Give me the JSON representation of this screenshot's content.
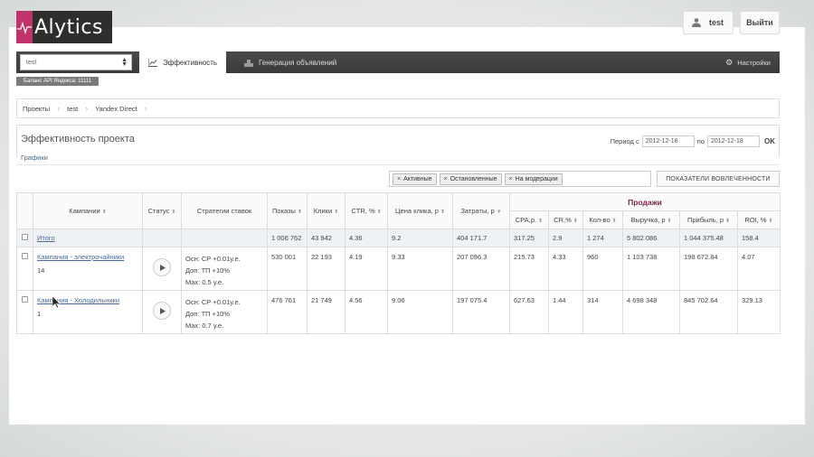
{
  "header": {
    "logo_text": "Alytics",
    "user_name": "test",
    "logout_label": "Выйти"
  },
  "navbar": {
    "project_select_value": "test",
    "tabs": [
      {
        "label": "Эффективность",
        "icon": "chart-line-icon",
        "active": true
      },
      {
        "label": "Генерация объявлений",
        "icon": "generator-icon",
        "active": false
      }
    ],
    "settings_label": "Настройки"
  },
  "api_balance": "Баланс API Яндекса: 11111",
  "breadcrumb": [
    "Проекты",
    "test",
    "Yandex Direct"
  ],
  "panel": {
    "title": "Эффективность проекта",
    "charts_link": "Графики",
    "period_label_from": "Период с",
    "period_from": "2012-12-18",
    "period_label_to": "по",
    "period_to": "2012-12-18",
    "ok_label": "OK"
  },
  "filters": {
    "tags": [
      "Активные",
      "Остановленные",
      "На модерации"
    ],
    "engagement_button": "ПОКАЗАТЕЛИ ВОВЛЕЧЕННОСТИ"
  },
  "table": {
    "sales_group_label": "Продажи",
    "columns": {
      "campaigns": "Кампании",
      "status": "Статус",
      "strategies": "Стратегии ставок",
      "impressions": "Показы",
      "clicks": "Клики",
      "ctr": "CTR, %",
      "cpc": "Цена клика, р",
      "cost": "Затраты, р",
      "cpa": "CPA,р.",
      "cr": "CR,%",
      "qty": "Кол-во",
      "revenue": "Выручка, р",
      "profit": "Прибыль, р",
      "roi": "ROI, %"
    },
    "total": {
      "label": "Итого",
      "impressions": "1 006 762",
      "clicks": "43 942",
      "ctr": "4.36",
      "cpc": "9.2",
      "cost": "404 171.7",
      "cpa": "317.25",
      "cr": "2.9",
      "qty": "1 274",
      "revenue": "5 802 086",
      "profit": "1 044 375.48",
      "roi": "158.4"
    },
    "rows": [
      {
        "name": "Кампания - электрочайники",
        "id": "14",
        "strategy": [
          "Осн: СР +0.01у.е.",
          "Доп: ТП +10%",
          "Max: 0.5 у.е."
        ],
        "impressions": "530 001",
        "clicks": "22 193",
        "ctr": "4.19",
        "cpc": "9.33",
        "cost": "207 096.3",
        "cpa": "215.73",
        "cr": "4.33",
        "qty": "960",
        "revenue": "1 103 738",
        "profit": "198 672.84",
        "roi": "4.07"
      },
      {
        "name": "Кампания - Холодильники",
        "id": "1",
        "strategy": [
          "Осн: СР +0.01у.е.",
          "Доп: ТП +10%",
          "Max: 0.7 у.е."
        ],
        "impressions": "476 761",
        "clicks": "21 749",
        "ctr": "4.56",
        "cpc": "9.06",
        "cost": "197 075.4",
        "cpa": "627.63",
        "cr": "1.44",
        "qty": "314",
        "revenue": "4 698 348",
        "profit": "845 702.64",
        "roi": "329.13"
      }
    ]
  },
  "colors": {
    "logo_accent": "#c0336b",
    "navbar_bg": "#3f3f3f",
    "sales_header": "#8b2048",
    "total_row_bg": "#eef1f6",
    "link": "#4a6a9a"
  }
}
